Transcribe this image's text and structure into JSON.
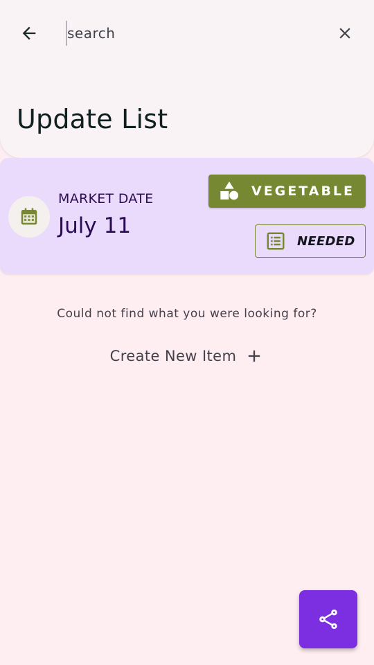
{
  "header": {
    "search": {
      "placeholder": "search",
      "value": ""
    },
    "title": "Update List",
    "icons": {
      "back": "arrow-left-icon",
      "close": "close-icon"
    }
  },
  "card": {
    "label": "MARKET DATE",
    "date": "July 11",
    "icon": "calendar-icon",
    "category_chip": {
      "label": "VEGETABLE",
      "icon": "shapes-icon",
      "color": "#778833"
    },
    "status_chip": {
      "label": "NEEDED",
      "icon": "list-icon",
      "border_color": "#778833"
    },
    "background": "#eadbfd"
  },
  "empty_state": {
    "message": "Could not find what you were looking for?",
    "create_label": "Create New Item",
    "create_icon": "plus-icon"
  },
  "fab": {
    "icon": "share-icon",
    "color": "#7b2fe0"
  }
}
